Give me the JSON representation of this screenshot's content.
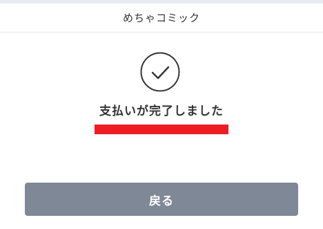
{
  "header": {
    "title": "めちゃコミック"
  },
  "status": {
    "icon": "check-circle-icon",
    "message": "支払いが完了しました"
  },
  "actions": {
    "back_label": "戻る"
  },
  "colors": {
    "highlight_bar": "#ee1d23",
    "button_bg": "#7f8896",
    "top_strip": "#e6ebf3"
  }
}
